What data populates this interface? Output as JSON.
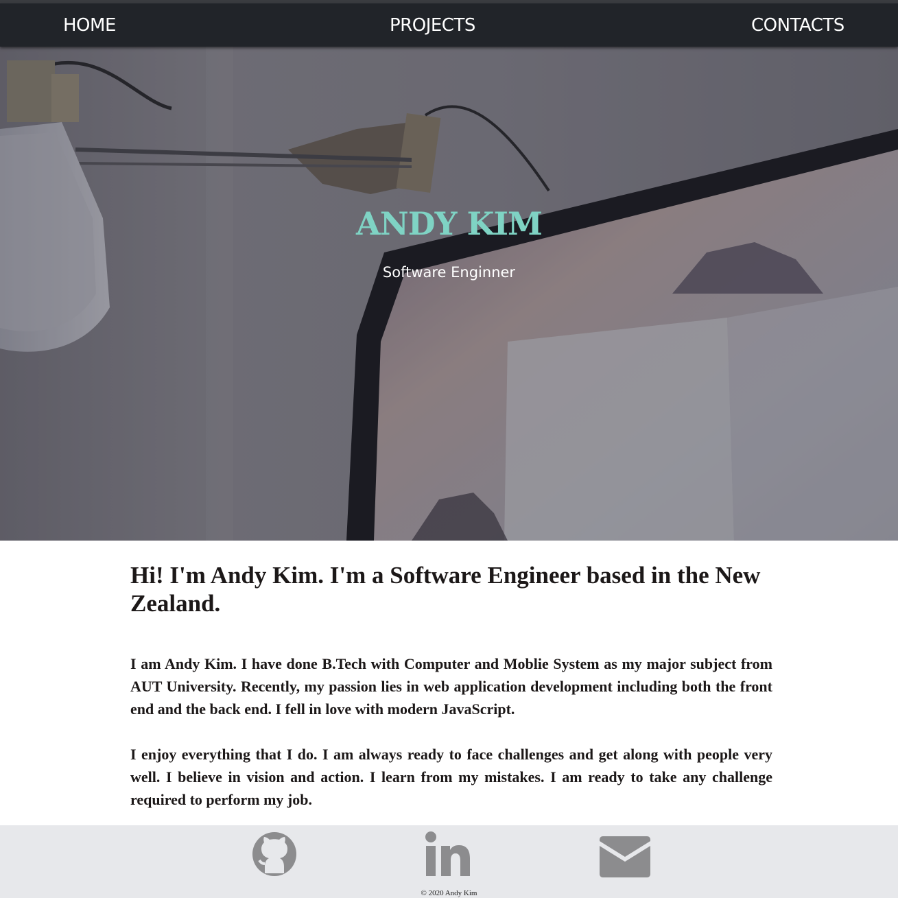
{
  "nav": {
    "home": "HOME",
    "projects": "PROJECTS",
    "contacts": "CONTACTS"
  },
  "hero": {
    "title": "ANDY KIM",
    "subtitle": "Software Enginner"
  },
  "about": {
    "heading": "Hi! I'm Andy Kim. I'm a Software Engineer based in the New Zealand.",
    "paragraphs": [
      "I am Andy Kim. I have done B.Tech with Computer and Moblie System as my major subject from AUT University. Recently, my passion lies in web application development including both the front end and the back end. I fell in love with modern JavaScript.",
      "I enjoy everything that I do. I am always ready to face challenges and get along with people very well. I believe in vision and action. I learn from my mistakes. I am ready to take any challenge required to perform my job."
    ]
  },
  "footer": {
    "social": [
      "github-icon",
      "linkedin-icon",
      "email-icon"
    ],
    "copyright": "© 2020 Andy Kim"
  },
  "colors": {
    "nav_bg": "#212429",
    "title_accent": "#7fd3c4",
    "footer_bg": "#e7e8eb",
    "icon_gray": "#8c8c8e",
    "text_dark": "#1c1818"
  }
}
